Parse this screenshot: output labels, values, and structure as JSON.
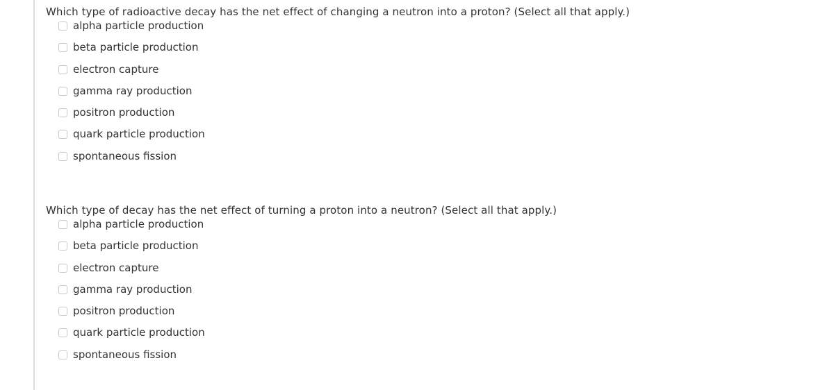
{
  "questions": [
    {
      "prompt": "Which type of radioactive decay has the net effect of changing a neutron into a proton? (Select all that apply.)",
      "options": [
        {
          "label": "alpha particle production",
          "checked": false
        },
        {
          "label": "beta particle production",
          "checked": false
        },
        {
          "label": "electron capture",
          "checked": false
        },
        {
          "label": "gamma ray production",
          "checked": false
        },
        {
          "label": "positron production",
          "checked": false
        },
        {
          "label": "quark particle production",
          "checked": false
        },
        {
          "label": "spontaneous fission",
          "checked": false
        }
      ]
    },
    {
      "prompt": "Which type of decay has the net effect of turning a proton into a neutron? (Select all that apply.)",
      "options": [
        {
          "label": "alpha particle production",
          "checked": false
        },
        {
          "label": "beta particle production",
          "checked": false
        },
        {
          "label": "electron capture",
          "checked": false
        },
        {
          "label": "gamma ray production",
          "checked": false
        },
        {
          "label": "positron production",
          "checked": false
        },
        {
          "label": "quark particle production",
          "checked": false
        },
        {
          "label": "spontaneous fission",
          "checked": false
        }
      ]
    }
  ]
}
